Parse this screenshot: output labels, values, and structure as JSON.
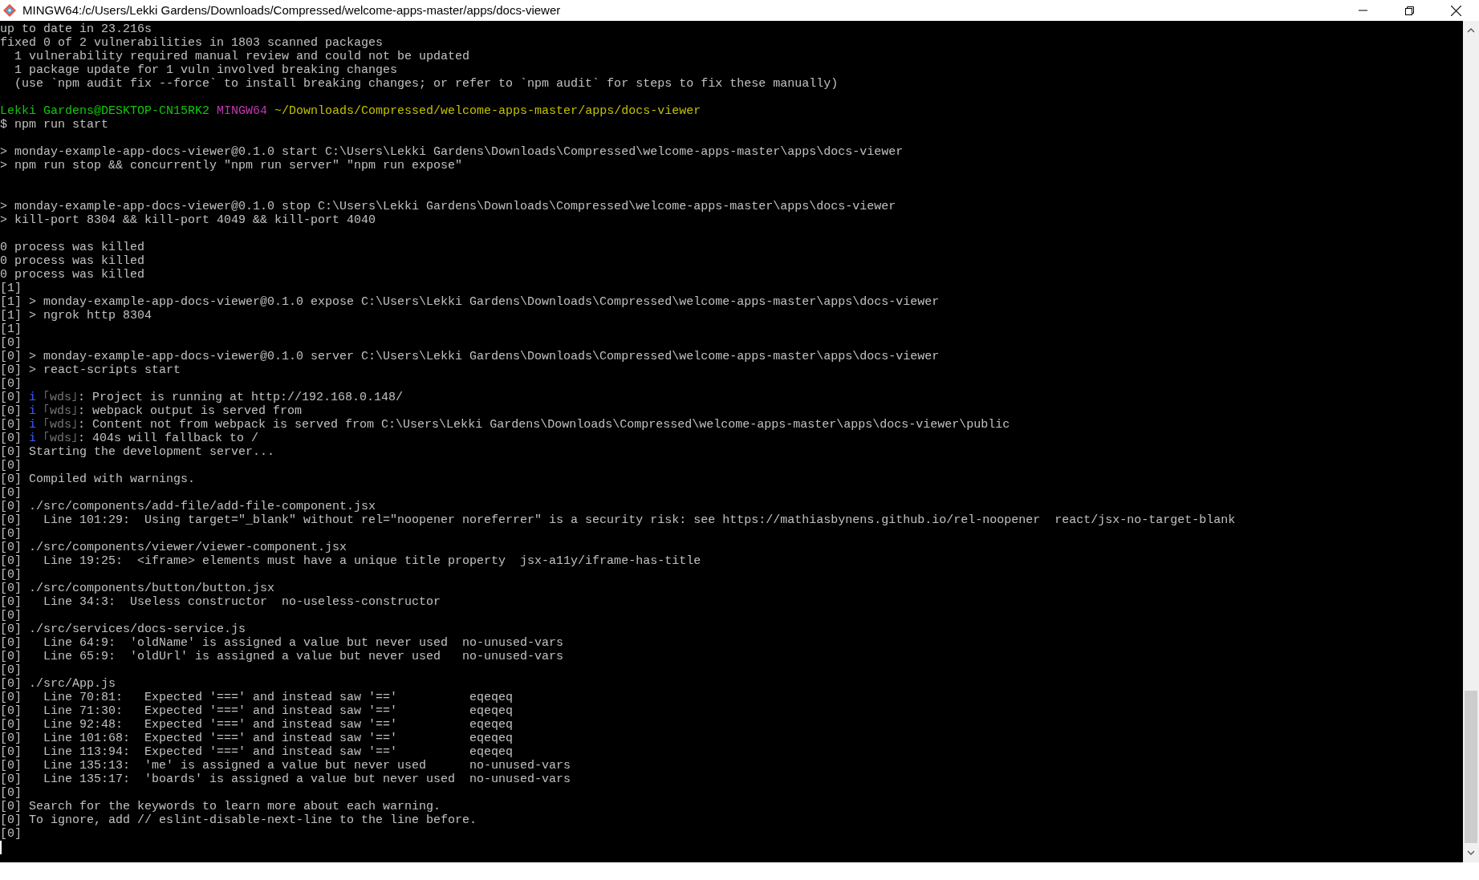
{
  "window": {
    "title": "MINGW64:/c/Users/Lekki Gardens/Downloads/Compressed/welcome-apps-master/apps/docs-viewer"
  },
  "terminal": {
    "lines": [
      {
        "kind": "text",
        "text": "up to date in 23.216s"
      },
      {
        "kind": "text",
        "text": "fixed 0 of 2 vulnerabilities in 1803 scanned packages"
      },
      {
        "kind": "text",
        "text": "  1 vulnerability required manual review and could not be updated"
      },
      {
        "kind": "text",
        "text": "  1 package update for 1 vuln involved breaking changes"
      },
      {
        "kind": "text",
        "text": "  (use `npm audit fix --force` to install breaking changes; or refer to `npm audit` for steps to fix these manually)"
      },
      {
        "kind": "blank"
      },
      {
        "kind": "segments",
        "segments": [
          {
            "kind": "user",
            "text": "Lekki Gardens@DESKTOP-CN15RK2"
          },
          {
            "kind": "system",
            "text": " MINGW64"
          },
          {
            "kind": "path",
            "text": " ~/Downloads/Compressed/welcome-apps-master/apps/docs-viewer"
          }
        ]
      },
      {
        "kind": "text",
        "text": "$ npm run start"
      },
      {
        "kind": "blank"
      },
      {
        "kind": "text",
        "text": "> monday-example-app-docs-viewer@0.1.0 start C:\\Users\\Lekki Gardens\\Downloads\\Compressed\\welcome-apps-master\\apps\\docs-viewer"
      },
      {
        "kind": "text",
        "text": "> npm run stop && concurrently \"npm run server\" \"npm run expose\""
      },
      {
        "kind": "blank"
      },
      {
        "kind": "blank"
      },
      {
        "kind": "text",
        "text": "> monday-example-app-docs-viewer@0.1.0 stop C:\\Users\\Lekki Gardens\\Downloads\\Compressed\\welcome-apps-master\\apps\\docs-viewer"
      },
      {
        "kind": "text",
        "text": "> kill-port 8304 && kill-port 4049 && kill-port 4040"
      },
      {
        "kind": "blank"
      },
      {
        "kind": "text",
        "text": "0 process was killed"
      },
      {
        "kind": "text",
        "text": "0 process was killed"
      },
      {
        "kind": "text",
        "text": "0 process was killed"
      },
      {
        "kind": "text",
        "text": "[1]"
      },
      {
        "kind": "text",
        "text": "[1] > monday-example-app-docs-viewer@0.1.0 expose C:\\Users\\Lekki Gardens\\Downloads\\Compressed\\welcome-apps-master\\apps\\docs-viewer"
      },
      {
        "kind": "text",
        "text": "[1] > ngrok http 8304"
      },
      {
        "kind": "text",
        "text": "[1]"
      },
      {
        "kind": "text",
        "text": "[0]"
      },
      {
        "kind": "text",
        "text": "[0] > monday-example-app-docs-viewer@0.1.0 server C:\\Users\\Lekki Gardens\\Downloads\\Compressed\\welcome-apps-master\\apps\\docs-viewer"
      },
      {
        "kind": "text",
        "text": "[0] > react-scripts start"
      },
      {
        "kind": "text",
        "text": "[0]"
      },
      {
        "kind": "segments",
        "segments": [
          {
            "kind": "plain",
            "text": "[0] "
          },
          {
            "kind": "info",
            "text": "i"
          },
          {
            "kind": "tag",
            "text": " ｢wds｣"
          },
          {
            "kind": "plain",
            "text": ": Project is running at http://192.168.0.148/"
          }
        ]
      },
      {
        "kind": "segments",
        "segments": [
          {
            "kind": "plain",
            "text": "[0] "
          },
          {
            "kind": "info",
            "text": "i"
          },
          {
            "kind": "tag",
            "text": " ｢wds｣"
          },
          {
            "kind": "plain",
            "text": ": webpack output is served from"
          }
        ]
      },
      {
        "kind": "segments",
        "segments": [
          {
            "kind": "plain",
            "text": "[0] "
          },
          {
            "kind": "info",
            "text": "i"
          },
          {
            "kind": "tag",
            "text": " ｢wds｣"
          },
          {
            "kind": "plain",
            "text": ": Content not from webpack is served from C:\\Users\\Lekki Gardens\\Downloads\\Compressed\\welcome-apps-master\\apps\\docs-viewer\\public"
          }
        ]
      },
      {
        "kind": "segments",
        "segments": [
          {
            "kind": "plain",
            "text": "[0] "
          },
          {
            "kind": "info",
            "text": "i"
          },
          {
            "kind": "tag",
            "text": " ｢wds｣"
          },
          {
            "kind": "plain",
            "text": ": 404s will fallback to /"
          }
        ]
      },
      {
        "kind": "text",
        "text": "[0] Starting the development server..."
      },
      {
        "kind": "text",
        "text": "[0]"
      },
      {
        "kind": "text",
        "text": "[0] Compiled with warnings."
      },
      {
        "kind": "text",
        "text": "[0]"
      },
      {
        "kind": "text",
        "text": "[0] ./src/components/add-file/add-file-component.jsx"
      },
      {
        "kind": "text",
        "text": "[0]   Line 101:29:  Using target=\"_blank\" without rel=\"noopener noreferrer\" is a security risk: see https://mathiasbynens.github.io/rel-noopener  react/jsx-no-target-blank"
      },
      {
        "kind": "text",
        "text": "[0]"
      },
      {
        "kind": "text",
        "text": "[0] ./src/components/viewer/viewer-component.jsx"
      },
      {
        "kind": "text",
        "text": "[0]   Line 19:25:  <iframe> elements must have a unique title property  jsx-a11y/iframe-has-title"
      },
      {
        "kind": "text",
        "text": "[0]"
      },
      {
        "kind": "text",
        "text": "[0] ./src/components/button/button.jsx"
      },
      {
        "kind": "text",
        "text": "[0]   Line 34:3:  Useless constructor  no-useless-constructor"
      },
      {
        "kind": "text",
        "text": "[0]"
      },
      {
        "kind": "text",
        "text": "[0] ./src/services/docs-service.js"
      },
      {
        "kind": "text",
        "text": "[0]   Line 64:9:  'oldName' is assigned a value but never used  no-unused-vars"
      },
      {
        "kind": "text",
        "text": "[0]   Line 65:9:  'oldUrl' is assigned a value but never used   no-unused-vars"
      },
      {
        "kind": "text",
        "text": "[0]"
      },
      {
        "kind": "text",
        "text": "[0] ./src/App.js"
      },
      {
        "kind": "text",
        "text": "[0]   Line 70:81:   Expected '===' and instead saw '=='          eqeqeq"
      },
      {
        "kind": "text",
        "text": "[0]   Line 71:30:   Expected '===' and instead saw '=='          eqeqeq"
      },
      {
        "kind": "text",
        "text": "[0]   Line 92:48:   Expected '===' and instead saw '=='          eqeqeq"
      },
      {
        "kind": "text",
        "text": "[0]   Line 101:68:  Expected '===' and instead saw '=='          eqeqeq"
      },
      {
        "kind": "text",
        "text": "[0]   Line 113:94:  Expected '===' and instead saw '=='          eqeqeq"
      },
      {
        "kind": "text",
        "text": "[0]   Line 135:13:  'me' is assigned a value but never used      no-unused-vars"
      },
      {
        "kind": "text",
        "text": "[0]   Line 135:17:  'boards' is assigned a value but never used  no-unused-vars"
      },
      {
        "kind": "text",
        "text": "[0]"
      },
      {
        "kind": "text",
        "text": "[0] Search for the keywords to learn more about each warning."
      },
      {
        "kind": "text",
        "text": "[0] To ignore, add // eslint-disable-next-line to the line before."
      },
      {
        "kind": "text",
        "text": "[0]"
      },
      {
        "kind": "cursor"
      }
    ]
  }
}
